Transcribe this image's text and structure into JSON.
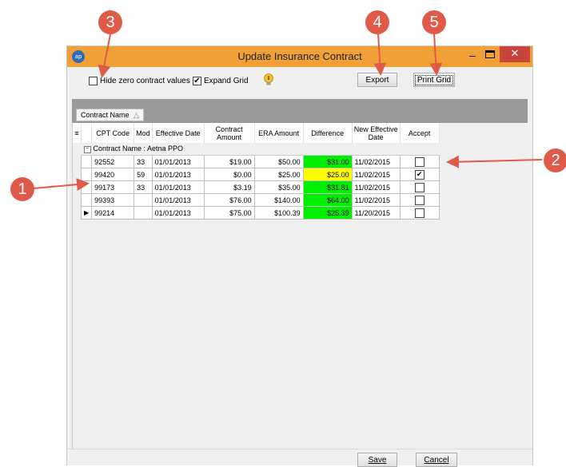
{
  "window": {
    "title": "Update Insurance Contract",
    "app_icon": "ap",
    "min_glyph": "–",
    "close_glyph": "✕"
  },
  "toolbar": {
    "hide_zero_label": "Hide zero contract values",
    "hide_zero_checked": false,
    "expand_grid_label": "Expand Grid",
    "expand_grid_checked": true,
    "export_label": "Export",
    "print_grid_label": "Print Grid"
  },
  "group_by": {
    "label": "Contract Name",
    "sort_glyph": "△"
  },
  "grid": {
    "columns": [
      "CPT Code",
      "Mod",
      "Effective Date",
      "Contract Amount",
      "ERA Amount",
      "Difference",
      "New Effective Date",
      "Accept"
    ],
    "group_label": "Contract Name : Aetna PPO",
    "rows": [
      {
        "cpt": "92552",
        "mod": "33",
        "eff": "01/01/2013",
        "contract": "$19.00",
        "era": "$50.00",
        "diff": "$31.00",
        "diff_color": "green",
        "new_eff": "11/02/2015",
        "accept": false,
        "current": false
      },
      {
        "cpt": "99420",
        "mod": "59",
        "eff": "01/01/2013",
        "contract": "$0.00",
        "era": "$25.00",
        "diff": "$25.00",
        "diff_color": "yellow",
        "new_eff": "11/02/2015",
        "accept": true,
        "current": false
      },
      {
        "cpt": "99173",
        "mod": "33",
        "eff": "01/01/2013",
        "contract": "$3.19",
        "era": "$35.00",
        "diff": "$31.81",
        "diff_color": "green",
        "new_eff": "11/02/2015",
        "accept": false,
        "current": false
      },
      {
        "cpt": "99393",
        "mod": "",
        "eff": "01/01/2013",
        "contract": "$76.00",
        "era": "$140.00",
        "diff": "$64.00",
        "diff_color": "green",
        "new_eff": "11/02/2015",
        "accept": false,
        "current": false
      },
      {
        "cpt": "99214",
        "mod": "",
        "eff": "01/01/2013",
        "contract": "$75.00",
        "era": "$100.39",
        "diff": "$25.39",
        "diff_color": "green",
        "new_eff": "11/20/2015",
        "accept": false,
        "current": true
      }
    ]
  },
  "footer": {
    "save_label": "Save",
    "cancel_label": "Cancel"
  },
  "callouts": [
    "1",
    "2",
    "3",
    "4",
    "5"
  ],
  "colors": {
    "callout": "#e05a49",
    "titlebar": "#f0a037",
    "close": "#c7453c",
    "green": "#00ee00",
    "yellow": "#ffff00"
  }
}
